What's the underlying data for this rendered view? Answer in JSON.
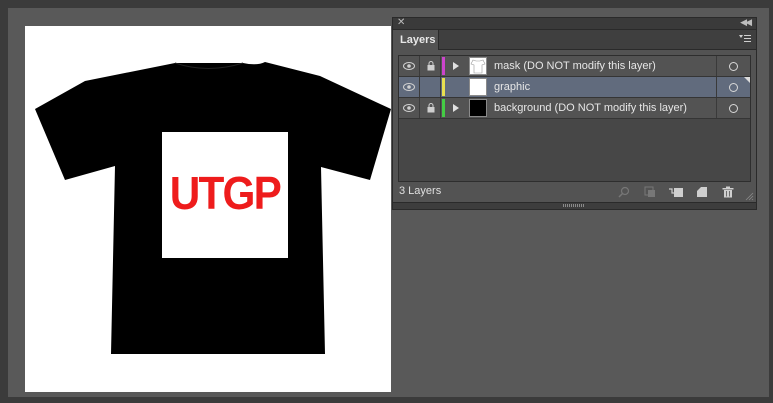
{
  "artboard": {
    "graphic_text": "UTGP",
    "colors": {
      "shirt": "#000000",
      "graphic_text": "#ee1c1c",
      "graphic_background": "#ffffff"
    }
  },
  "panel": {
    "close_icon": "close-icon",
    "collapse_icon": "double-chevron-left-icon",
    "tab_label": "Layers",
    "menu_icon": "panel-menu-icon",
    "layers": [
      {
        "name": "mask (DO NOT modify this layer)",
        "color": "#cc44cc",
        "locked": true,
        "expandable": true,
        "visible": true,
        "selected": false,
        "thumb": "mask"
      },
      {
        "name": "graphic",
        "color": "#e8e050",
        "locked": false,
        "expandable": false,
        "visible": true,
        "selected": true,
        "thumb": "white"
      },
      {
        "name": "background (DO NOT modify this layer)",
        "color": "#44cc44",
        "locked": true,
        "expandable": true,
        "visible": true,
        "selected": false,
        "thumb": "black"
      }
    ],
    "footer": {
      "count_label": "3 Layers",
      "icons": [
        "locate-object-icon",
        "make-clipping-mask-icon",
        "new-sublayer-icon",
        "new-layer-icon",
        "delete-layer-icon"
      ]
    }
  }
}
